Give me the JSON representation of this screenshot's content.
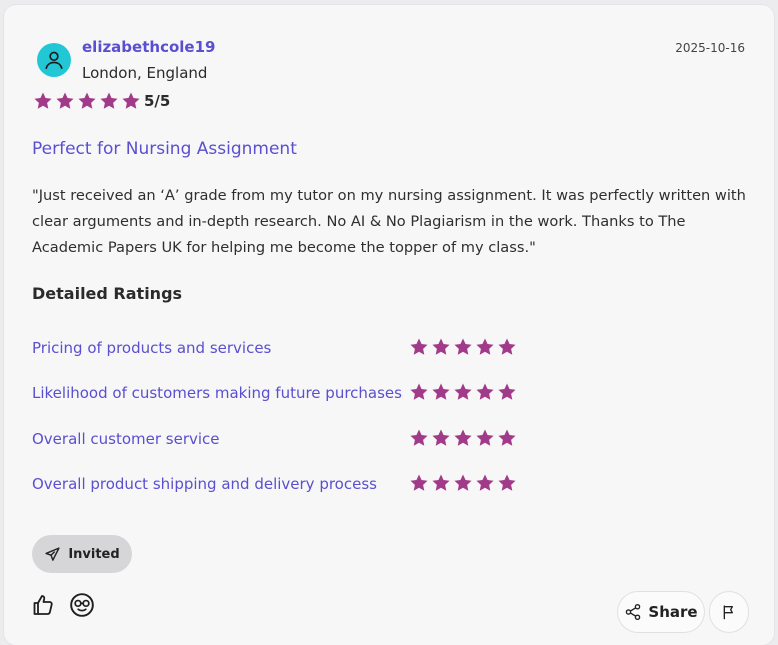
{
  "review": {
    "username": "elizabethcole19",
    "location": "London, England",
    "date": "2025-10-16",
    "rating_stars": 5,
    "rating_text": "5/5",
    "title": "Perfect for Nursing Assignment",
    "body": "\"Just received an ‘A’ grade from my tutor on my nursing assignment. It was perfectly written with clear arguments and in-depth research. No AI & No Plagiarism in the work. Thanks to The Academic Papers UK for helping me become the topper of my class.\""
  },
  "detailed": {
    "heading": "Detailed Ratings",
    "items": [
      {
        "label": "Pricing of products and services",
        "stars": 5
      },
      {
        "label": "Likelihood of customers making future purchases",
        "stars": 5
      },
      {
        "label": "Overall customer service",
        "stars": 5
      },
      {
        "label": "Overall product shipping and delivery process",
        "stars": 5
      }
    ]
  },
  "actions": {
    "invited_label": "Invited",
    "share_label": "Share"
  },
  "icons": {
    "avatar": "user-icon",
    "star": "star-icon",
    "invited": "paper-plane-icon",
    "like": "thumbs-up-icon",
    "emoji": "nerd-face-icon",
    "share": "share-nodes-icon",
    "flag": "flag-icon"
  },
  "colors": {
    "star": "#a23a8a",
    "accent": "#5a4fcf",
    "avatar": "#22c7d6"
  }
}
